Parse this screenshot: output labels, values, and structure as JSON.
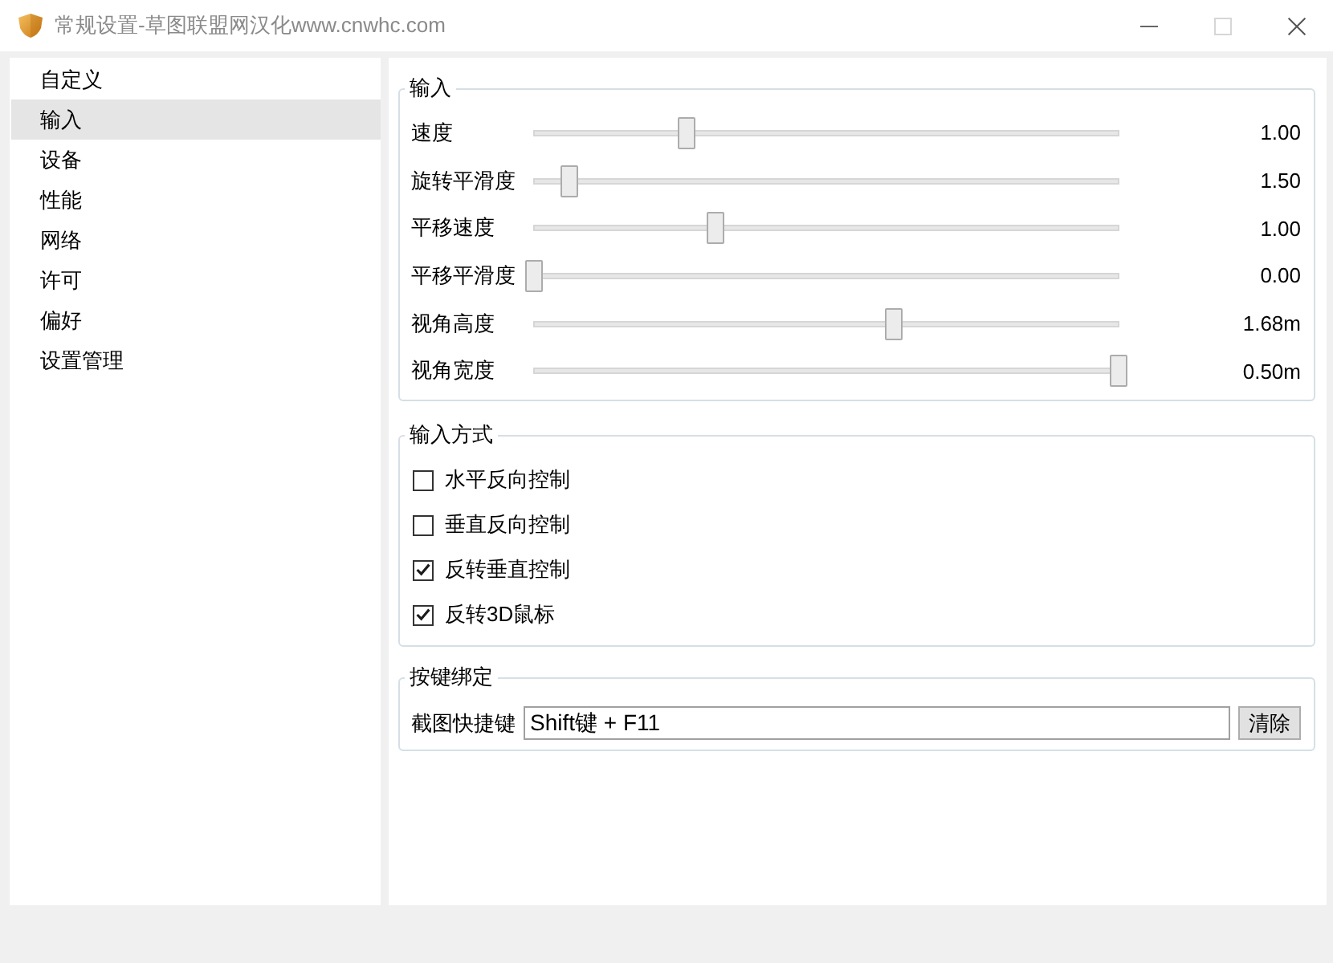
{
  "window": {
    "title": "常规设置-草图联盟网汉化www.cnwhc.com",
    "maximize_disabled": true
  },
  "sidebar": {
    "items": [
      {
        "label": "自定义",
        "selected": false
      },
      {
        "label": "输入",
        "selected": true
      },
      {
        "label": "设备",
        "selected": false
      },
      {
        "label": "性能",
        "selected": false
      },
      {
        "label": "网络",
        "selected": false
      },
      {
        "label": "许可",
        "selected": false
      },
      {
        "label": "偏好",
        "selected": false
      },
      {
        "label": "设置管理",
        "selected": false
      }
    ]
  },
  "groups": [
    {
      "kind": "sliders",
      "title": "输入",
      "rows": [
        {
          "label": "速度",
          "level": 0.26,
          "reading": "1.00"
        },
        {
          "label": "旋转平滑度",
          "level": 0.06,
          "reading": "1.50"
        },
        {
          "label": "平移速度",
          "level": 0.31,
          "reading": "1.00"
        },
        {
          "label": "平移平滑度",
          "level": 0,
          "reading": "0.00"
        },
        {
          "label": "视角高度",
          "level": 0.615,
          "reading": "1.68m"
        },
        {
          "label": "视角宽度",
          "level": 1,
          "reading": "0.50m"
        }
      ]
    },
    {
      "kind": "checkboxes",
      "title": "输入方式",
      "rows": [
        {
          "label": "水平反向控制",
          "checked": false
        },
        {
          "label": "垂直反向控制",
          "checked": false
        },
        {
          "label": "反转垂直控制",
          "checked": true
        },
        {
          "label": "反转3D鼠标",
          "checked": true
        }
      ]
    },
    {
      "kind": "shortcut",
      "title": "按键绑定",
      "rows": [
        {
          "label": "截图快捷键",
          "value": "Shift键 + F11",
          "button": "清除"
        }
      ]
    }
  ]
}
